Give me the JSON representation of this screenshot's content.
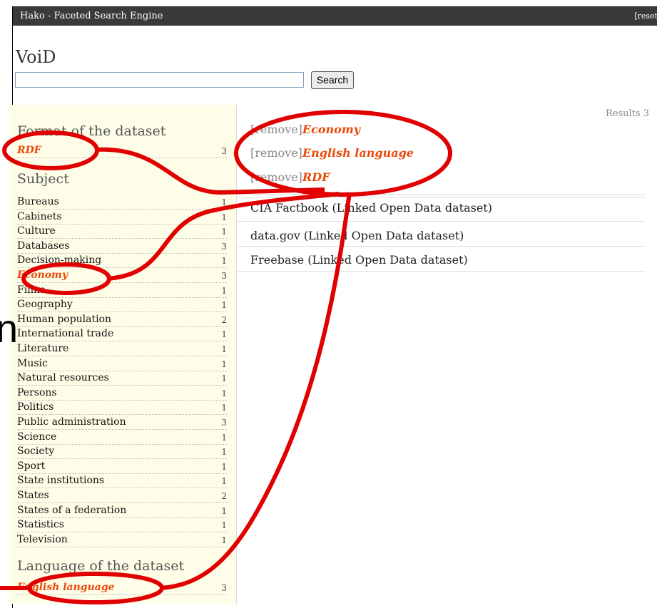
{
  "window": {
    "title": "Hako - Faceted Search Engine",
    "reset_label": "[reset"
  },
  "app_title": "VoiD",
  "search": {
    "value": "",
    "button_label": "Search"
  },
  "facets": {
    "format": {
      "heading": "Format of the dataset",
      "items": [
        {
          "label": "RDF",
          "count": "3",
          "selected": true
        }
      ]
    },
    "subject": {
      "heading": "Subject",
      "items": [
        {
          "label": "Bureaus",
          "count": "1"
        },
        {
          "label": "Cabinets",
          "count": "1"
        },
        {
          "label": "Culture",
          "count": "1"
        },
        {
          "label": "Databases",
          "count": "3"
        },
        {
          "label": "Decision-making",
          "count": "1"
        },
        {
          "label": "Economy",
          "count": "3",
          "selected": true
        },
        {
          "label": "Films",
          "count": "1"
        },
        {
          "label": "Geography",
          "count": "1"
        },
        {
          "label": "Human population",
          "count": "2"
        },
        {
          "label": "International trade",
          "count": "1"
        },
        {
          "label": "Literature",
          "count": "1"
        },
        {
          "label": "Music",
          "count": "1"
        },
        {
          "label": "Natural resources",
          "count": "1"
        },
        {
          "label": "Persons",
          "count": "1"
        },
        {
          "label": "Politics",
          "count": "1"
        },
        {
          "label": "Public administration",
          "count": "3"
        },
        {
          "label": "Science",
          "count": "1"
        },
        {
          "label": "Society",
          "count": "1"
        },
        {
          "label": "Sport",
          "count": "1"
        },
        {
          "label": "State institutions",
          "count": "1"
        },
        {
          "label": "States",
          "count": "2"
        },
        {
          "label": "States of a federation",
          "count": "1"
        },
        {
          "label": "Statistics",
          "count": "1"
        },
        {
          "label": "Television",
          "count": "1"
        }
      ]
    },
    "language": {
      "heading": "Language of the dataset",
      "items": [
        {
          "label": "English language",
          "count": "3",
          "selected": true
        }
      ]
    }
  },
  "main": {
    "results_label": "Results 3",
    "active_filters": [
      {
        "remove": "[remove]",
        "value": "Economy"
      },
      {
        "remove": "[remove]",
        "value": "English language"
      },
      {
        "remove": "[remove]",
        "value": "RDF"
      }
    ],
    "results": [
      {
        "title": "CIA Factbook (Linked Open Data dataset)"
      },
      {
        "title": "data.gov (Linked Open Data dataset)"
      },
      {
        "title": "Freebase (Linked Open Data dataset)"
      }
    ]
  },
  "annotation": {
    "color": "#e00000",
    "cropped_text": "n"
  }
}
